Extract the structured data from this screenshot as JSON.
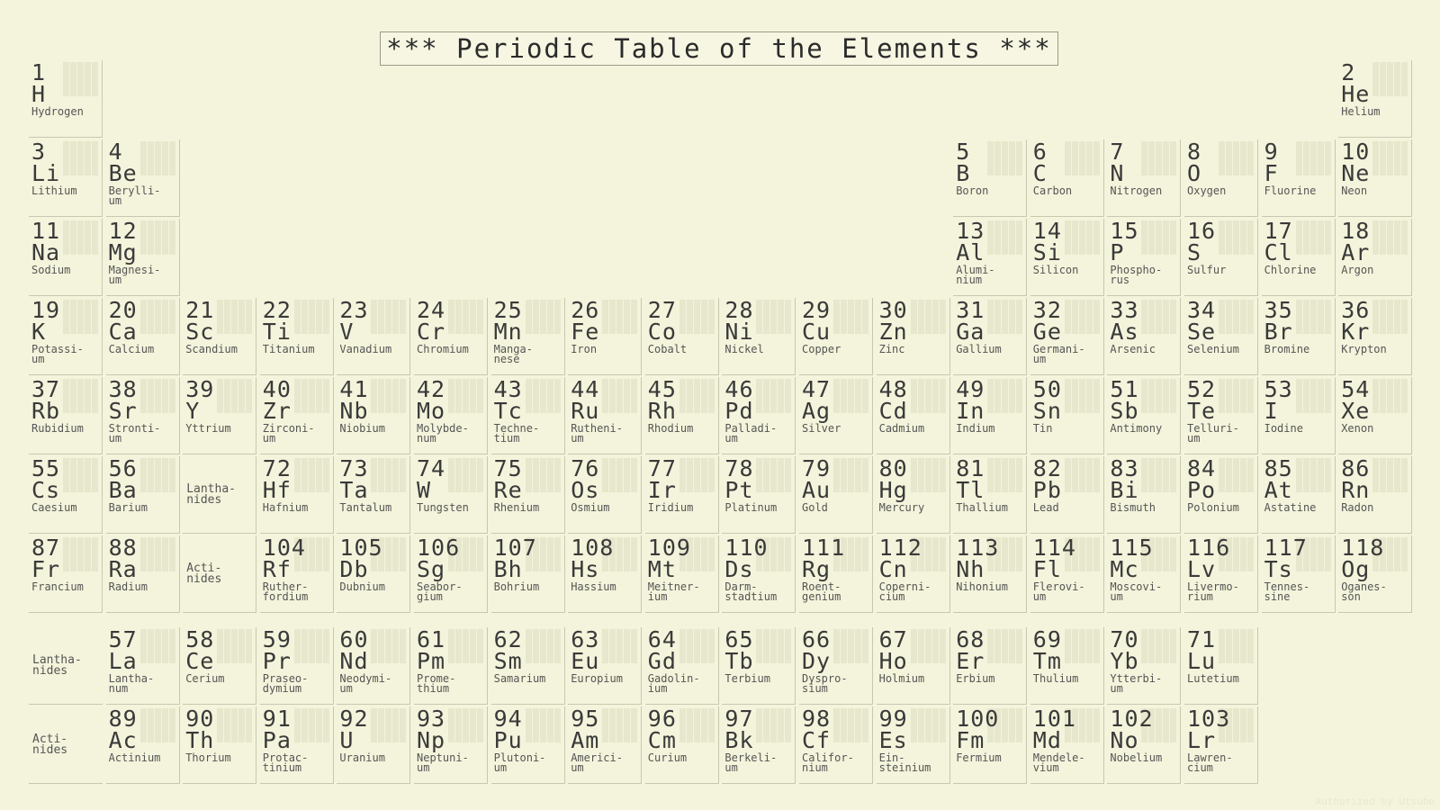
{
  "title": "*** Periodic Table of the Elements ***",
  "watermark": "Authorized by Utsubo",
  "colors": {
    "background": "#f4f4dc",
    "text": "#2f2f2f",
    "cell_border": "#c8c8b0",
    "dot_matrix": "#e7e7cd"
  },
  "lanthanides_label": "Lantha-\nnides",
  "actinides_label": "Acti-\nnides",
  "elements": [
    {
      "n": "1",
      "s": "H",
      "name": "Hydrogen",
      "period": 1,
      "group": 1
    },
    {
      "n": "2",
      "s": "He",
      "name": "Helium",
      "period": 1,
      "group": 18
    },
    {
      "n": "3",
      "s": "Li",
      "name": "Lithium",
      "period": 2,
      "group": 1
    },
    {
      "n": "4",
      "s": "Be",
      "name": "Berylli-\num",
      "period": 2,
      "group": 2
    },
    {
      "n": "5",
      "s": "B",
      "name": "Boron",
      "period": 2,
      "group": 13
    },
    {
      "n": "6",
      "s": "C",
      "name": "Carbon",
      "period": 2,
      "group": 14
    },
    {
      "n": "7",
      "s": "N",
      "name": "Nitrogen",
      "period": 2,
      "group": 15
    },
    {
      "n": "8",
      "s": "O",
      "name": "Oxygen",
      "period": 2,
      "group": 16
    },
    {
      "n": "9",
      "s": "F",
      "name": "Fluorine",
      "period": 2,
      "group": 17
    },
    {
      "n": "10",
      "s": "Ne",
      "name": "Neon",
      "period": 2,
      "group": 18
    },
    {
      "n": "11",
      "s": "Na",
      "name": "Sodium",
      "period": 3,
      "group": 1
    },
    {
      "n": "12",
      "s": "Mg",
      "name": "Magnesi-\num",
      "period": 3,
      "group": 2
    },
    {
      "n": "13",
      "s": "Al",
      "name": "Alumi-\nnium",
      "period": 3,
      "group": 13
    },
    {
      "n": "14",
      "s": "Si",
      "name": "Silicon",
      "period": 3,
      "group": 14
    },
    {
      "n": "15",
      "s": "P",
      "name": "Phospho-\nrus",
      "period": 3,
      "group": 15
    },
    {
      "n": "16",
      "s": "S",
      "name": "Sulfur",
      "period": 3,
      "group": 16
    },
    {
      "n": "17",
      "s": "Cl",
      "name": "Chlorine",
      "period": 3,
      "group": 17
    },
    {
      "n": "18",
      "s": "Ar",
      "name": "Argon",
      "period": 3,
      "group": 18
    },
    {
      "n": "19",
      "s": "K",
      "name": "Potassi-\num",
      "period": 4,
      "group": 1
    },
    {
      "n": "20",
      "s": "Ca",
      "name": "Calcium",
      "period": 4,
      "group": 2
    },
    {
      "n": "21",
      "s": "Sc",
      "name": "Scandium",
      "period": 4,
      "group": 3
    },
    {
      "n": "22",
      "s": "Ti",
      "name": "Titanium",
      "period": 4,
      "group": 4
    },
    {
      "n": "23",
      "s": "V",
      "name": "Vanadium",
      "period": 4,
      "group": 5
    },
    {
      "n": "24",
      "s": "Cr",
      "name": "Chromium",
      "period": 4,
      "group": 6
    },
    {
      "n": "25",
      "s": "Mn",
      "name": "Manga-\nnese",
      "period": 4,
      "group": 7
    },
    {
      "n": "26",
      "s": "Fe",
      "name": "Iron",
      "period": 4,
      "group": 8
    },
    {
      "n": "27",
      "s": "Co",
      "name": "Cobalt",
      "period": 4,
      "group": 9
    },
    {
      "n": "28",
      "s": "Ni",
      "name": "Nickel",
      "period": 4,
      "group": 10
    },
    {
      "n": "29",
      "s": "Cu",
      "name": "Copper",
      "period": 4,
      "group": 11
    },
    {
      "n": "30",
      "s": "Zn",
      "name": "Zinc",
      "period": 4,
      "group": 12
    },
    {
      "n": "31",
      "s": "Ga",
      "name": "Gallium",
      "period": 4,
      "group": 13
    },
    {
      "n": "32",
      "s": "Ge",
      "name": "Germani-\num",
      "period": 4,
      "group": 14
    },
    {
      "n": "33",
      "s": "As",
      "name": "Arsenic",
      "period": 4,
      "group": 15
    },
    {
      "n": "34",
      "s": "Se",
      "name": "Selenium",
      "period": 4,
      "group": 16
    },
    {
      "n": "35",
      "s": "Br",
      "name": "Bromine",
      "period": 4,
      "group": 17
    },
    {
      "n": "36",
      "s": "Kr",
      "name": "Krypton",
      "period": 4,
      "group": 18
    },
    {
      "n": "37",
      "s": "Rb",
      "name": "Rubidium",
      "period": 5,
      "group": 1
    },
    {
      "n": "38",
      "s": "Sr",
      "name": "Stronti-\num",
      "period": 5,
      "group": 2
    },
    {
      "n": "39",
      "s": "Y",
      "name": "Yttrium",
      "period": 5,
      "group": 3
    },
    {
      "n": "40",
      "s": "Zr",
      "name": "Zirconi-\num",
      "period": 5,
      "group": 4
    },
    {
      "n": "41",
      "s": "Nb",
      "name": "Niobium",
      "period": 5,
      "group": 5
    },
    {
      "n": "42",
      "s": "Mo",
      "name": "Molybde-\nnum",
      "period": 5,
      "group": 6
    },
    {
      "n": "43",
      "s": "Tc",
      "name": "Techne-\ntium",
      "period": 5,
      "group": 7
    },
    {
      "n": "44",
      "s": "Ru",
      "name": "Rutheni-\num",
      "period": 5,
      "group": 8
    },
    {
      "n": "45",
      "s": "Rh",
      "name": "Rhodium",
      "period": 5,
      "group": 9
    },
    {
      "n": "46",
      "s": "Pd",
      "name": "Palladi-\num",
      "period": 5,
      "group": 10
    },
    {
      "n": "47",
      "s": "Ag",
      "name": "Silver",
      "period": 5,
      "group": 11
    },
    {
      "n": "48",
      "s": "Cd",
      "name": "Cadmium",
      "period": 5,
      "group": 12
    },
    {
      "n": "49",
      "s": "In",
      "name": "Indium",
      "period": 5,
      "group": 13
    },
    {
      "n": "50",
      "s": "Sn",
      "name": "Tin",
      "period": 5,
      "group": 14
    },
    {
      "n": "51",
      "s": "Sb",
      "name": "Antimony",
      "period": 5,
      "group": 15
    },
    {
      "n": "52",
      "s": "Te",
      "name": "Telluri-\num",
      "period": 5,
      "group": 16
    },
    {
      "n": "53",
      "s": "I",
      "name": "Iodine",
      "period": 5,
      "group": 17
    },
    {
      "n": "54",
      "s": "Xe",
      "name": "Xenon",
      "period": 5,
      "group": 18
    },
    {
      "n": "55",
      "s": "Cs",
      "name": "Caesium",
      "period": 6,
      "group": 1
    },
    {
      "n": "56",
      "s": "Ba",
      "name": "Barium",
      "period": 6,
      "group": 2
    },
    {
      "n": "72",
      "s": "Hf",
      "name": "Hafnium",
      "period": 6,
      "group": 4
    },
    {
      "n": "73",
      "s": "Ta",
      "name": "Tantalum",
      "period": 6,
      "group": 5
    },
    {
      "n": "74",
      "s": "W",
      "name": "Tungsten",
      "period": 6,
      "group": 6
    },
    {
      "n": "75",
      "s": "Re",
      "name": "Rhenium",
      "period": 6,
      "group": 7
    },
    {
      "n": "76",
      "s": "Os",
      "name": "Osmium",
      "period": 6,
      "group": 8
    },
    {
      "n": "77",
      "s": "Ir",
      "name": "Iridium",
      "period": 6,
      "group": 9
    },
    {
      "n": "78",
      "s": "Pt",
      "name": "Platinum",
      "period": 6,
      "group": 10
    },
    {
      "n": "79",
      "s": "Au",
      "name": "Gold",
      "period": 6,
      "group": 11
    },
    {
      "n": "80",
      "s": "Hg",
      "name": "Mercury",
      "period": 6,
      "group": 12
    },
    {
      "n": "81",
      "s": "Tl",
      "name": "Thallium",
      "period": 6,
      "group": 13
    },
    {
      "n": "82",
      "s": "Pb",
      "name": "Lead",
      "period": 6,
      "group": 14
    },
    {
      "n": "83",
      "s": "Bi",
      "name": "Bismuth",
      "period": 6,
      "group": 15
    },
    {
      "n": "84",
      "s": "Po",
      "name": "Polonium",
      "period": 6,
      "group": 16
    },
    {
      "n": "85",
      "s": "At",
      "name": "Astatine",
      "period": 6,
      "group": 17
    },
    {
      "n": "86",
      "s": "Rn",
      "name": "Radon",
      "period": 6,
      "group": 18
    },
    {
      "n": "87",
      "s": "Fr",
      "name": "Francium",
      "period": 7,
      "group": 1
    },
    {
      "n": "88",
      "s": "Ra",
      "name": "Radium",
      "period": 7,
      "group": 2
    },
    {
      "n": "104",
      "s": "Rf",
      "name": "Ruther-\nfordium",
      "period": 7,
      "group": 4
    },
    {
      "n": "105",
      "s": "Db",
      "name": "Dubnium",
      "period": 7,
      "group": 5
    },
    {
      "n": "106",
      "s": "Sg",
      "name": "Seabor-\ngium",
      "period": 7,
      "group": 6
    },
    {
      "n": "107",
      "s": "Bh",
      "name": "Bohrium",
      "period": 7,
      "group": 7
    },
    {
      "n": "108",
      "s": "Hs",
      "name": "Hassium",
      "period": 7,
      "group": 8
    },
    {
      "n": "109",
      "s": "Mt",
      "name": "Meitner-\nium",
      "period": 7,
      "group": 9
    },
    {
      "n": "110",
      "s": "Ds",
      "name": "Darm-\nstadtium",
      "period": 7,
      "group": 10
    },
    {
      "n": "111",
      "s": "Rg",
      "name": "Roent-\ngenium",
      "period": 7,
      "group": 11
    },
    {
      "n": "112",
      "s": "Cn",
      "name": "Coperni-\ncium",
      "period": 7,
      "group": 12
    },
    {
      "n": "113",
      "s": "Nh",
      "name": "Nihonium",
      "period": 7,
      "group": 13
    },
    {
      "n": "114",
      "s": "Fl",
      "name": "Flerovi-\num",
      "period": 7,
      "group": 14
    },
    {
      "n": "115",
      "s": "Mc",
      "name": "Moscovi-\num",
      "period": 7,
      "group": 15
    },
    {
      "n": "116",
      "s": "Lv",
      "name": "Livermo-\nrium",
      "period": 7,
      "group": 16
    },
    {
      "n": "117",
      "s": "Ts",
      "name": "Tennes-\nsine",
      "period": 7,
      "group": 17
    },
    {
      "n": "118",
      "s": "Og",
      "name": "Oganes-\nson",
      "period": 7,
      "group": 18
    },
    {
      "n": "57",
      "s": "La",
      "name": "Lantha-\nnum",
      "period": 9,
      "group": 2
    },
    {
      "n": "58",
      "s": "Ce",
      "name": "Cerium",
      "period": 9,
      "group": 3
    },
    {
      "n": "59",
      "s": "Pr",
      "name": "Praseo-\ndymium",
      "period": 9,
      "group": 4
    },
    {
      "n": "60",
      "s": "Nd",
      "name": "Neodymi-\num",
      "period": 9,
      "group": 5
    },
    {
      "n": "61",
      "s": "Pm",
      "name": "Prome-\nthium",
      "period": 9,
      "group": 6
    },
    {
      "n": "62",
      "s": "Sm",
      "name": "Samarium",
      "period": 9,
      "group": 7
    },
    {
      "n": "63",
      "s": "Eu",
      "name": "Europium",
      "period": 9,
      "group": 8
    },
    {
      "n": "64",
      "s": "Gd",
      "name": "Gadolin-\nium",
      "period": 9,
      "group": 9
    },
    {
      "n": "65",
      "s": "Tb",
      "name": "Terbium",
      "period": 9,
      "group": 10
    },
    {
      "n": "66",
      "s": "Dy",
      "name": "Dyspro-\nsium",
      "period": 9,
      "group": 11
    },
    {
      "n": "67",
      "s": "Ho",
      "name": "Holmium",
      "period": 9,
      "group": 12
    },
    {
      "n": "68",
      "s": "Er",
      "name": "Erbium",
      "period": 9,
      "group": 13
    },
    {
      "n": "69",
      "s": "Tm",
      "name": "Thulium",
      "period": 9,
      "group": 14
    },
    {
      "n": "70",
      "s": "Yb",
      "name": "Ytterbi-\num",
      "period": 9,
      "group": 15
    },
    {
      "n": "71",
      "s": "Lu",
      "name": "Lutetium",
      "period": 9,
      "group": 16
    },
    {
      "n": "89",
      "s": "Ac",
      "name": "Actinium",
      "period": 10,
      "group": 2
    },
    {
      "n": "90",
      "s": "Th",
      "name": "Thorium",
      "period": 10,
      "group": 3
    },
    {
      "n": "91",
      "s": "Pa",
      "name": "Protac-\ntinium",
      "period": 10,
      "group": 4
    },
    {
      "n": "92",
      "s": "U",
      "name": "Uranium",
      "period": 10,
      "group": 5
    },
    {
      "n": "93",
      "s": "Np",
      "name": "Neptuni-\num",
      "period": 10,
      "group": 6
    },
    {
      "n": "94",
      "s": "Pu",
      "name": "Plutoni-\num",
      "period": 10,
      "group": 7
    },
    {
      "n": "95",
      "s": "Am",
      "name": "Americi-\num",
      "period": 10,
      "group": 8
    },
    {
      "n": "96",
      "s": "Cm",
      "name": "Curium",
      "period": 10,
      "group": 9
    },
    {
      "n": "97",
      "s": "Bk",
      "name": "Berkeli-\num",
      "period": 10,
      "group": 10
    },
    {
      "n": "98",
      "s": "Cf",
      "name": "Califor-\nnium",
      "period": 10,
      "group": 11
    },
    {
      "n": "99",
      "s": "Es",
      "name": "Ein-\nsteinium",
      "period": 10,
      "group": 12
    },
    {
      "n": "100",
      "s": "Fm",
      "name": "Fermium",
      "period": 10,
      "group": 13
    },
    {
      "n": "101",
      "s": "Md",
      "name": "Mendele-\nvium",
      "period": 10,
      "group": 14
    },
    {
      "n": "102",
      "s": "No",
      "name": "Nobelium",
      "period": 10,
      "group": 15
    },
    {
      "n": "103",
      "s": "Lr",
      "name": "Lawren-\ncium",
      "period": 10,
      "group": 16
    }
  ]
}
